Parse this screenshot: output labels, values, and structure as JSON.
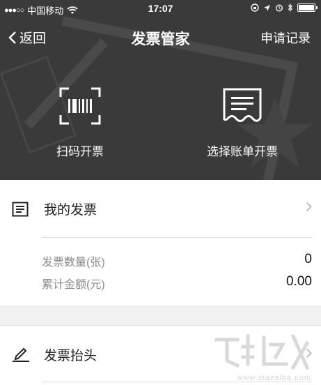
{
  "status_bar": {
    "signal": "●●●○○",
    "carrier": "中国移动",
    "time": "17:07"
  },
  "nav": {
    "back_label": "返回",
    "title": "发票管家",
    "right_label": "申请记录"
  },
  "actions": [
    {
      "label": "扫码开票",
      "icon": "barcode-scan-icon"
    },
    {
      "label": "选择账单开票",
      "icon": "receipt-icon"
    }
  ],
  "my_invoices": {
    "label": "我的发票",
    "icon": "invoice-list-icon",
    "stats": [
      {
        "label": "发票数量(张)",
        "value": "0"
      },
      {
        "label": "累计金额(元)",
        "value": "0.00"
      }
    ]
  },
  "invoice_header": {
    "label": "发票抬头",
    "icon": "pencil-icon"
  },
  "watermark": {
    "text": "www.xiazaiba.com"
  },
  "colors": {
    "header_bg": "#3a3a3a",
    "page_bg": "#f2f2f2",
    "divider": "#e0e0e0"
  }
}
